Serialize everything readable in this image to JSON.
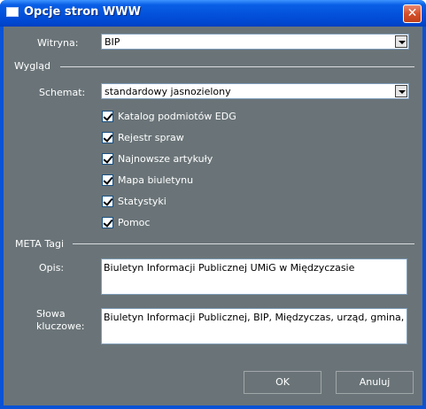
{
  "window": {
    "title": "Opcje stron WWW",
    "close_label": "✕"
  },
  "form": {
    "site_label": "Witryna:",
    "site_value": "BIP",
    "appearance_section": "Wygląd",
    "scheme_label": "Schemat:",
    "scheme_value": "standardowy jasnozielony",
    "checkboxes": [
      {
        "label": "Katalog podmiotów EDG",
        "checked": true
      },
      {
        "label": "Rejestr spraw",
        "checked": true
      },
      {
        "label": "Najnowsze artykuły",
        "checked": true
      },
      {
        "label": "Mapa biuletynu",
        "checked": true
      },
      {
        "label": "Statystyki",
        "checked": true
      },
      {
        "label": "Pomoc",
        "checked": true
      }
    ],
    "meta_section": "META Tagi",
    "description_label": "Opis:",
    "description_value": "Biuletyn Informacji Publicznej UMiG w Międzyczasie",
    "keywords_label_1": "Słowa",
    "keywords_label_2": "kluczowe:",
    "keywords_value": "Biuletyn Informacji Publicznej, BIP, Międzyczas, urząd, gmina,"
  },
  "buttons": {
    "ok": "OK",
    "cancel": "Anuluj"
  }
}
